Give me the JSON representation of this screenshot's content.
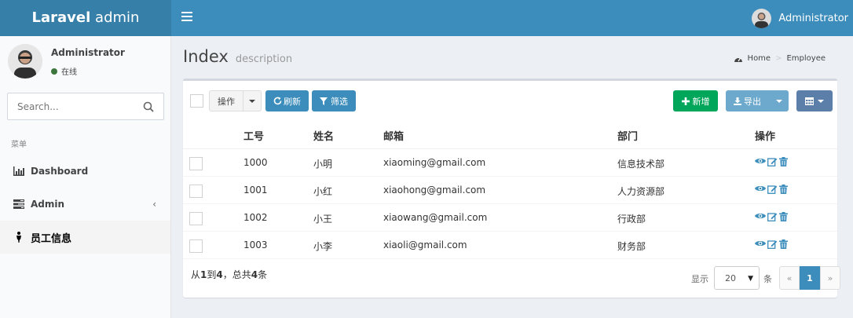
{
  "brand": {
    "bold": "Laravel",
    "rest": " admin"
  },
  "header": {
    "username": "Administrator"
  },
  "sidebar": {
    "user": {
      "name": "Administrator",
      "status": "在线"
    },
    "search_placeholder": "Search...",
    "menu_header": "菜单",
    "items": [
      {
        "label": "Dashboard",
        "icon": "bar-chart-icon"
      },
      {
        "label": "Admin",
        "icon": "tasks-icon"
      },
      {
        "label": "员工信息",
        "icon": "person-icon",
        "active": true
      }
    ]
  },
  "page": {
    "title": "Index",
    "description": "description"
  },
  "breadcrumb": {
    "home": "Home",
    "current": "Employee"
  },
  "toolbar": {
    "actions": "操作",
    "refresh": "刷新",
    "filter": "筛选",
    "new": "新增",
    "export": "导出"
  },
  "table": {
    "columns": [
      "工号",
      "姓名",
      "邮箱",
      "部门",
      "操作"
    ],
    "rows": [
      {
        "id": "1000",
        "name": "小明",
        "email": "xiaoming@gmail.com",
        "dept": "信息技术部"
      },
      {
        "id": "1001",
        "name": "小红",
        "email": "xiaohong@gmail.com",
        "dept": "人力资源部"
      },
      {
        "id": "1002",
        "name": "小王",
        "email": "xiaowang@gmail.com",
        "dept": "行政部"
      },
      {
        "id": "1003",
        "name": "小李",
        "email": "xiaoli@gmail.com",
        "dept": "财务部"
      }
    ]
  },
  "footer": {
    "info": {
      "from": "从",
      "start": "1",
      "to": "到",
      "end": "4",
      "sep": "，总共",
      "total": "4",
      "unit": "条"
    },
    "per_page_label": "显示",
    "per_page_value": "20",
    "per_page_unit": "条",
    "pager": {
      "prev": "«",
      "current": "1",
      "next": "»"
    }
  },
  "colors": {
    "topbar": "#3c8dbc",
    "logo_bg": "#367fa9",
    "primary": "#3c8dbc",
    "success": "#00a65a",
    "online": "#3c763d"
  }
}
